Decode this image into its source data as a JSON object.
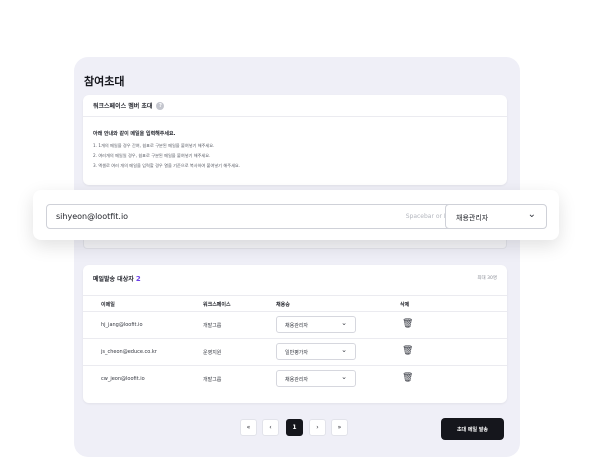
{
  "page_title": "참여초대",
  "invite_card": {
    "header": "워크스페이스 멤버 초대",
    "help_icon": "question-icon",
    "guide_title": "아래 안내와 같이 메일을 입력해주세요.",
    "guide_lines": [
      "1. 1개의 메일을 경우 간여, 쉼표로 구분된 메일을 붙여넣기 해주세요.",
      "2. 여러개의 메일일 경우, 쉼표로 구분된 메일을 붙여넣기 해주세요.",
      "3. 엑셀로 여러 개의 메일을 입력할 경우 열을 기준으로 복사하여 붙여넣기 해주세요."
    ]
  },
  "email_entry": {
    "value": "sihyeon@lootfit.io",
    "placeholder": "Spacebar or Enter",
    "role_selected": "채용관리자"
  },
  "recipients": {
    "title": "메일발송 대상자",
    "count": "2",
    "max_label": "최대 30명",
    "columns": [
      "이메일",
      "워크스페이스",
      "채용승",
      "삭제"
    ],
    "rows": [
      {
        "email": "hj_jang@loofit.io",
        "workspace": "개발그룹",
        "role": "채용관리자"
      },
      {
        "email": "js_cheon@educe.co.kr",
        "workspace": "운영지원",
        "role": "일반평가자"
      },
      {
        "email": "cw_jeon@loofit.io",
        "workspace": "개발그룹",
        "role": "채용관리자"
      }
    ]
  },
  "pagination": {
    "first": "«",
    "prev": "‹",
    "current": "1",
    "next": "›",
    "last": "»"
  },
  "send_button": "초대 메일 발송"
}
